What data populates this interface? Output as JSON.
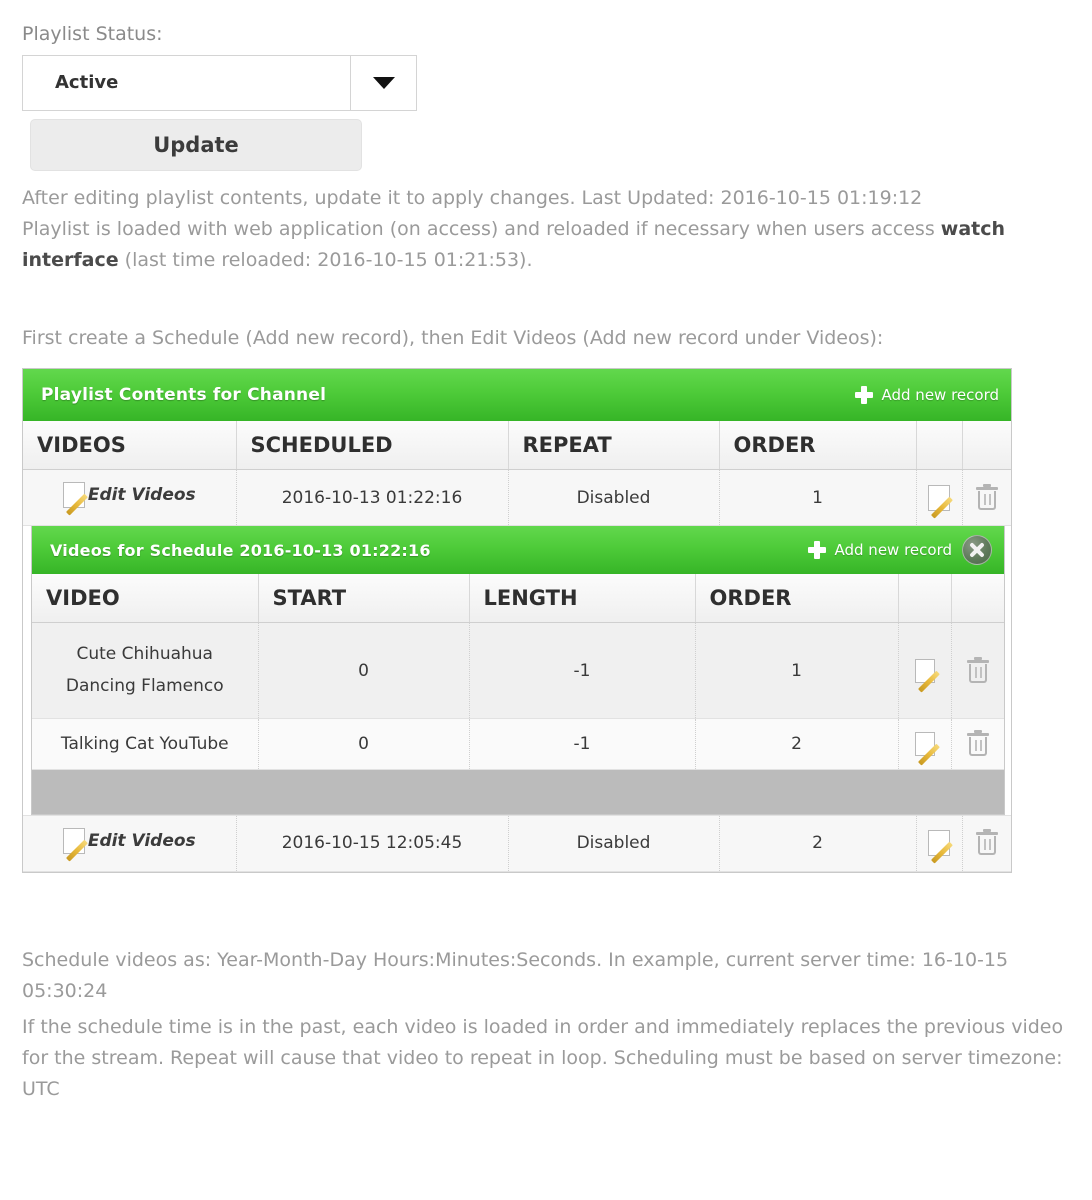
{
  "form": {
    "status_label": "Playlist Status:",
    "status_value": "Active",
    "status_options": [
      "Active"
    ],
    "update_label": "Update",
    "dropdown_icon": "chevron-down-icon"
  },
  "notes": {
    "line1": "After editing playlist contents, update it to apply changes. Last Updated: 2016-10-15 01:19:12",
    "line2_a": "Playlist is loaded with web application (on access) and reloaded if necessary when users access ",
    "line2_bold": "watch interface",
    "line2_b": " (last time reloaded: 2016-10-15 01:21:53).",
    "first_create": "First create a Schedule (Add new record), then Edit Videos (Add new record under Videos):",
    "bottom1": "Schedule videos as: Year-Month-Day Hours:Minutes:Seconds. In example, current server time: 16-10-15 05:30:24",
    "bottom2": "If the schedule time is in the past, each video is loaded in order and immediately replaces the previous video for the stream. Repeat will cause that video to repeat in loop. Scheduling must be based on server timezone: UTC"
  },
  "outer_grid": {
    "title": "Playlist Contents for Channel",
    "add_label": "Add new record",
    "add_icon": "plus-icon",
    "headers": [
      "VIDEOS",
      "SCHEDULED",
      "REPEAT",
      "ORDER",
      "",
      ""
    ],
    "rows": [
      {
        "edit_videos_label": "Edit Videos",
        "edit_videos_icon": "edit-icon",
        "scheduled": "2016-10-13 01:22:16",
        "repeat": "Disabled",
        "order": "1",
        "row_edit_icon": "edit-icon",
        "row_delete_icon": "trash-icon"
      },
      {
        "edit_videos_label": "Edit Videos",
        "edit_videos_icon": "edit-icon",
        "scheduled": "2016-10-15 12:05:45",
        "repeat": "Disabled",
        "order": "2",
        "row_edit_icon": "edit-icon",
        "row_delete_icon": "trash-icon"
      }
    ]
  },
  "nested_grid": {
    "title": "Videos for Schedule 2016-10-13 01:22:16",
    "add_label": "Add new record",
    "add_icon": "plus-icon",
    "close_icon": "close-circle-icon",
    "headers": [
      "VIDEO",
      "START",
      "LENGTH",
      "ORDER",
      "",
      ""
    ],
    "rows": [
      {
        "video": "Cute Chihuahua Dancing Flamenco",
        "start": "0",
        "length": "-1",
        "order": "1",
        "row_edit_icon": "edit-icon",
        "row_delete_icon": "trash-icon"
      },
      {
        "video": "Talking Cat YouTube",
        "start": "0",
        "length": "-1",
        "order": "2",
        "row_edit_icon": "edit-icon",
        "row_delete_icon": "trash-icon"
      }
    ]
  },
  "colors": {
    "green_top": "#62d84d",
    "green_bottom": "#36b527",
    "gray_strip": "#bbbbbb",
    "pencil_gold": "#e8b93b",
    "text_muted": "#9a9a9a"
  }
}
